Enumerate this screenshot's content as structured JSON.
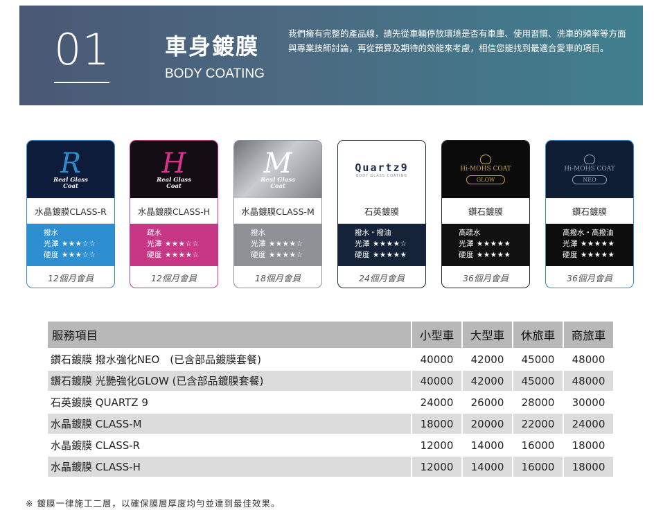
{
  "banner": {
    "number": "01",
    "title_zh": "車身鍍膜",
    "title_en": "BODY COATING",
    "description": "我們擁有完整的產品線，請先從車輛停放環境是否有車庫、使用習慣、洗車的頻率等方面與專業技師討論，再從預算及期待的效能來考慮，相信您能找到最適合愛車的項目。"
  },
  "cards": [
    {
      "logo_main": "R",
      "logo_sub": "Real Glass",
      "logo_sub2": "Coat",
      "name": "水晶鍍膜CLASS-R",
      "line1": "撥水",
      "line2": "光澤 ★★★☆☆",
      "line3": "硬度 ★★★☆☆",
      "member": "12個月會員",
      "logo_bg": "#0d1c3a",
      "logo_color": "#2f8bcb",
      "spec_bg": "#2d8fd0",
      "border": "#2f8bcb"
    },
    {
      "logo_main": "H",
      "logo_sub": "Real Glass",
      "logo_sub2": "Coat",
      "name": "水晶鍍膜CLASS-H",
      "line1": "疏水",
      "line2": "光澤 ★★★☆☆",
      "line3": "硬度 ★★★★☆",
      "member": "12個月會員",
      "logo_bg": "#140d13",
      "logo_color": "#d6348b",
      "spec_bg": "#c83786",
      "border": "#c83786"
    },
    {
      "logo_main": "M",
      "logo_sub": "Real Glass",
      "logo_sub2": "Coat",
      "name": "水晶鍍膜CLASS-M",
      "line1": "撥水",
      "line2": "光澤 ★★★★☆",
      "line3": "硬度 ★★★★☆",
      "member": "18個月會員",
      "logo_bg": "#9a9ea3",
      "logo_color": "#ffffff",
      "spec_bg": "#8e9297",
      "border": "#8e9297"
    },
    {
      "logo_main": "Quartz9",
      "logo_sub": "BODY GLASS COATING",
      "logo_sub2": "",
      "name": "石英鍍膜",
      "line1": "撥水・撥油",
      "line2": "光澤 ★★★★☆",
      "line3": "硬度 ★★★★★",
      "member": "24個月會員",
      "logo_bg": "#ffffff",
      "logo_color": "#1a2a45",
      "spec_bg": "#152338",
      "border": "#152338"
    },
    {
      "logo_main": "Hi-MOHS COAT",
      "logo_sub": "GLOW",
      "logo_sub2": "",
      "name": "鑽石鍍膜",
      "line1": "高疏水",
      "line2": "光澤 ★★★★★",
      "line3": "硬度 ★★★★★",
      "member": "36個月會員",
      "logo_bg": "#0b0b0b",
      "logo_color": "#c9a54a",
      "spec_bg": "#111111",
      "border": "#222222"
    },
    {
      "logo_main": "Hi-MOHS COAT",
      "logo_sub": "NEO",
      "logo_sub2": "",
      "name": "鑽石鍍膜",
      "line1": "高撥水・高撥油",
      "line2": "光澤 ★★★★★",
      "line3": "硬度 ★★★★★",
      "member": "36個月會員",
      "logo_bg": "#0e1d33",
      "logo_color": "#8fa4b8",
      "spec_bg": "#0c0c0c",
      "border": "#2f8bcb"
    }
  ],
  "table": {
    "headers": [
      "服務項目",
      "小型車",
      "大型車",
      "休旅車",
      "商旅車"
    ],
    "rows": [
      {
        "service": "鑽石鍍膜 撥水強化NEO　(已含部品鍍膜套餐)",
        "prices": [
          "40000",
          "42000",
          "45000",
          "48000"
        ]
      },
      {
        "service": "鑽石鍍膜 光艷強化GLOW (已含部品鍍膜套餐)",
        "prices": [
          "40000",
          "42000",
          "45000",
          "48000"
        ]
      },
      {
        "service": "石英鍍膜 QUARTZ 9",
        "prices": [
          "24000",
          "26000",
          "28000",
          "30000"
        ]
      },
      {
        "service": "水晶鍍膜 CLASS-M",
        "prices": [
          "18000",
          "20000",
          "22000",
          "24000"
        ]
      },
      {
        "service": "水晶鍍膜 CLASS-R",
        "prices": [
          "12000",
          "14000",
          "16000",
          "18000"
        ]
      },
      {
        "service": "水晶鍍膜 CLASS-H",
        "prices": [
          "12000",
          "14000",
          "16000",
          "18000"
        ]
      }
    ]
  },
  "note": "※ 鍍膜一律施工二層，以確保膜層厚度均勻並達到最佳效果。"
}
